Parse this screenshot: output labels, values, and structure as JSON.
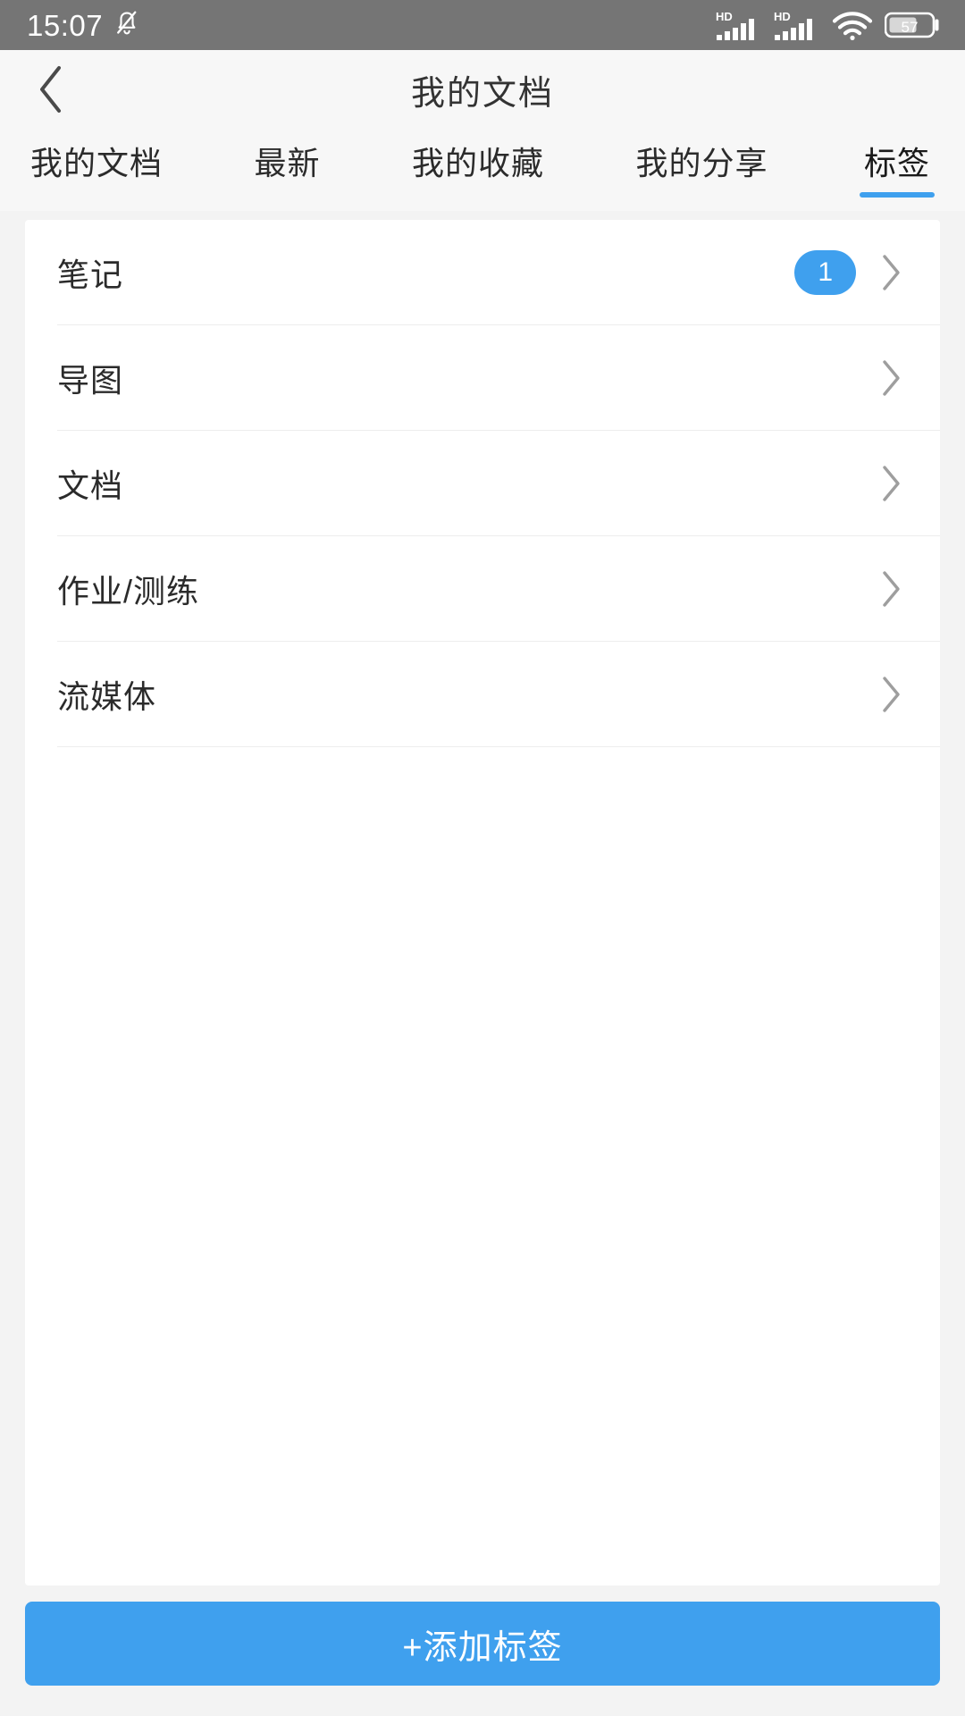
{
  "status_bar": {
    "time": "15:07",
    "icons": {
      "mute": "bell-mute-icon",
      "signal_1": "signal-hd-icon",
      "signal_2": "signal-hd-icon",
      "wifi": "wifi-icon",
      "battery": "battery-icon"
    },
    "network_label": "HD",
    "battery_level": "57",
    "background_color": "#757575"
  },
  "header": {
    "back_icon": "chevron-left-icon",
    "title": "我的文档"
  },
  "tabs": {
    "active_index": 4,
    "items": [
      {
        "label": "我的文档"
      },
      {
        "label": "最新"
      },
      {
        "label": "我的收藏"
      },
      {
        "label": "我的分享"
      },
      {
        "label": "标签"
      }
    ],
    "indicator_color": "#3fa0ee"
  },
  "list": {
    "rows": [
      {
        "label": "笔记",
        "badge": "1",
        "chevron": "chevron-right-icon"
      },
      {
        "label": "导图",
        "badge": "",
        "chevron": "chevron-right-icon"
      },
      {
        "label": "文档",
        "badge": "",
        "chevron": "chevron-right-icon"
      },
      {
        "label": "作业/测练",
        "badge": "",
        "chevron": "chevron-right-icon"
      },
      {
        "label": "流媒体",
        "badge": "",
        "chevron": "chevron-right-icon"
      }
    ],
    "badge_color": "#3fa0ee"
  },
  "footer": {
    "add_label": "+添加标签",
    "button_color": "#3fa0ee"
  }
}
